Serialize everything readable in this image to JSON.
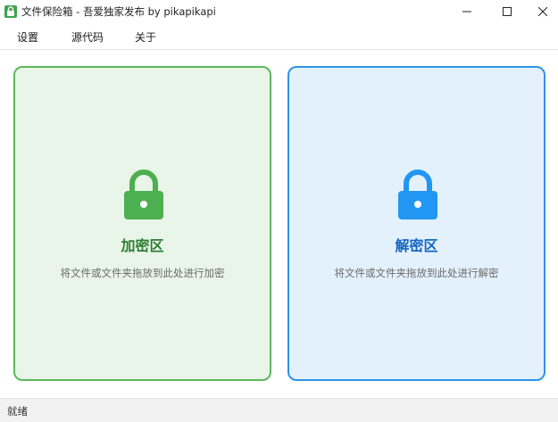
{
  "window": {
    "title": "文件保险箱 - 吾爱独家发布 by pikapikapi"
  },
  "menu": {
    "settings": "设置",
    "source_code": "源代码",
    "about": "关于"
  },
  "panels": {
    "encrypt": {
      "title": "加密区",
      "hint": "将文件或文件夹拖放到此处进行加密",
      "color": "#4caf50",
      "border": "#5cb85c",
      "background": "#e9f5e8",
      "icon": "lock-icon"
    },
    "decrypt": {
      "title": "解密区",
      "hint": "将文件或文件夹拖放到此处进行解密",
      "color": "#2196f3",
      "border": "#2e94e6",
      "background": "#e3f1fc",
      "icon": "lock-icon"
    }
  },
  "status": {
    "text": "就绪"
  }
}
